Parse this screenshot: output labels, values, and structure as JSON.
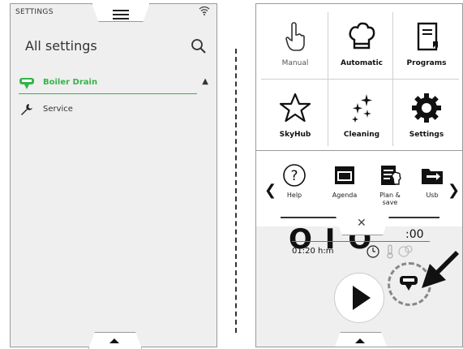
{
  "left_panel": {
    "header_title": "SETTINGS",
    "page_title": "All settings",
    "items": [
      {
        "label": "Boiler Drain",
        "selected": true,
        "icon": "boiler-drain-icon"
      },
      {
        "label": "Service",
        "selected": false,
        "icon": "wrench-icon"
      }
    ]
  },
  "right_panel": {
    "main_menu": [
      {
        "label": "Manual",
        "icon": "hand-pointer-icon"
      },
      {
        "label": "Automatic",
        "icon": "chef-hat-icon"
      },
      {
        "label": "Programs",
        "icon": "book-icon"
      },
      {
        "label": "SkyHub",
        "icon": "star-icon"
      },
      {
        "label": "Cleaning",
        "icon": "sparkle-icon"
      },
      {
        "label": "Settings",
        "icon": "gear-icon"
      }
    ],
    "quick_bar": [
      {
        "label": "Help",
        "icon": "help-icon"
      },
      {
        "label": "Agenda",
        "icon": "agenda-icon"
      },
      {
        "label": "Plan & save",
        "icon": "plan-save-icon"
      },
      {
        "label": "Usb",
        "icon": "usb-folder-icon"
      }
    ],
    "clock_minutes": ":00",
    "duration": "01:20 h:m"
  },
  "colors": {
    "accent_green": "#37b34a",
    "panel_bg": "#efefef"
  }
}
